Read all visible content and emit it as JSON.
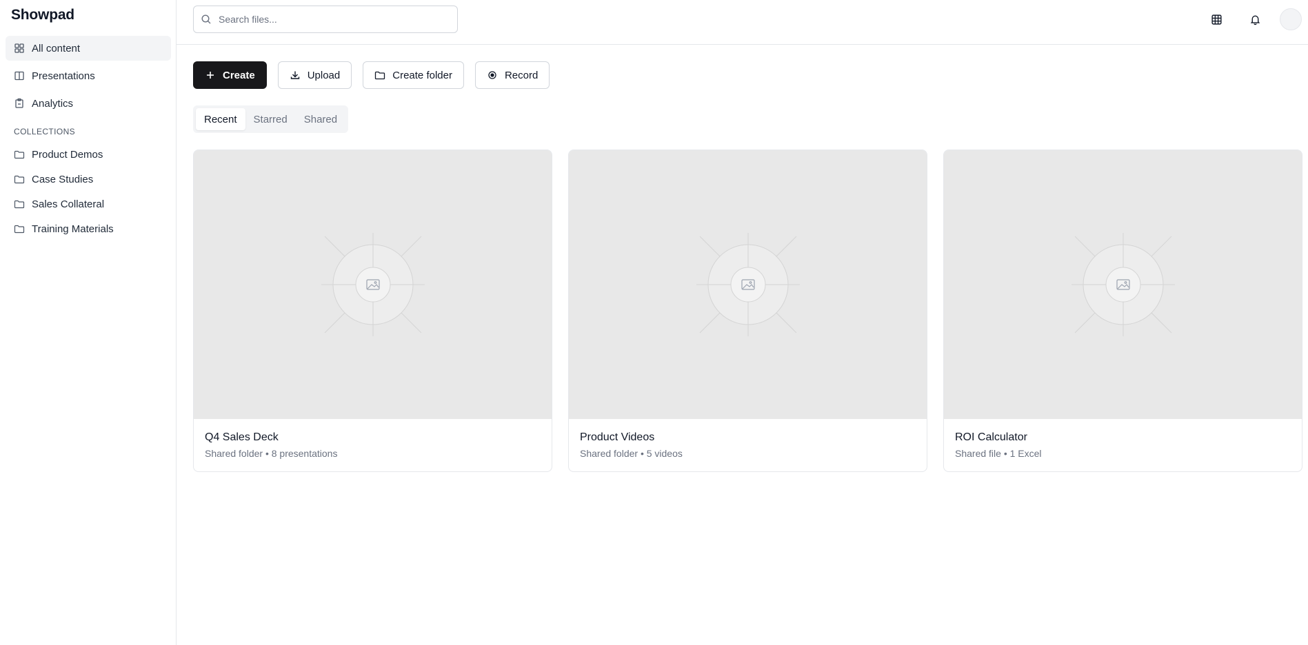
{
  "app": {
    "name": "Showpad"
  },
  "sidebar": {
    "nav": [
      {
        "label": "All content",
        "icon": "grid-icon",
        "active": true
      },
      {
        "label": "Presentations",
        "icon": "book-icon",
        "active": false
      },
      {
        "label": "Analytics",
        "icon": "clipboard-icon",
        "active": false
      }
    ],
    "collections_label": "COLLECTIONS",
    "collections": [
      {
        "label": "Product Demos",
        "icon": "folder-icon"
      },
      {
        "label": "Case Studies",
        "icon": "folder-icon"
      },
      {
        "label": "Sales Collateral",
        "icon": "folder-icon"
      },
      {
        "label": "Training Materials",
        "icon": "folder-icon"
      }
    ]
  },
  "header": {
    "search": {
      "placeholder": "Search files...",
      "value": ""
    },
    "icons": [
      "apps-grid-icon",
      "bell-icon",
      "avatar"
    ]
  },
  "actions": {
    "create": "Create",
    "upload": "Upload",
    "create_folder": "Create folder",
    "record": "Record"
  },
  "tabs": [
    {
      "label": "Recent",
      "active": true
    },
    {
      "label": "Starred",
      "active": false
    },
    {
      "label": "Shared",
      "active": false
    }
  ],
  "cards": [
    {
      "title": "Q4 Sales Deck",
      "subtitle": "Shared folder • 8 presentations"
    },
    {
      "title": "Product Videos",
      "subtitle": "Shared folder • 5 videos"
    },
    {
      "title": "ROI Calculator",
      "subtitle": "Shared file • 1 Excel"
    }
  ],
  "colors": {
    "primary": "#18181b",
    "placeholder_bg": "#e8e8e8",
    "border": "#e5e7eb",
    "muted_text": "#6b7280"
  }
}
